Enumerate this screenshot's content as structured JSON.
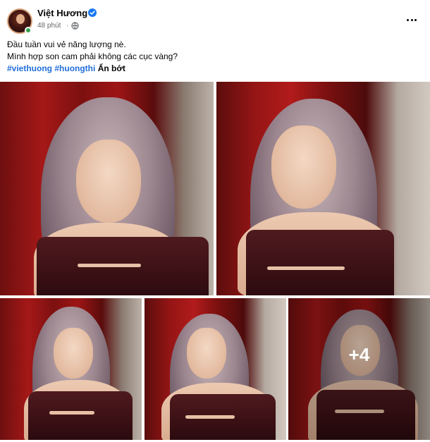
{
  "post": {
    "author": "Việt Hương",
    "time": "48 phút",
    "separator": "·",
    "privacy_icon": "globe-icon",
    "verified_icon": "verified-badge-icon",
    "more_icon": "more-options-icon",
    "caption_lines": [
      "Đầu tuần vui vẻ năng lượng nè.",
      "Mình hợp son cam phải không các cục vàng?"
    ],
    "hashtags": [
      "#viethuong",
      "#huongthi"
    ],
    "see_less": "Ẩn bớt",
    "extra_photos_label": "+4"
  },
  "colors": {
    "link_blue": "#216fdb",
    "verified_blue": "#1877f2",
    "online_green": "#31a24c",
    "secondary_text": "#65676b"
  }
}
